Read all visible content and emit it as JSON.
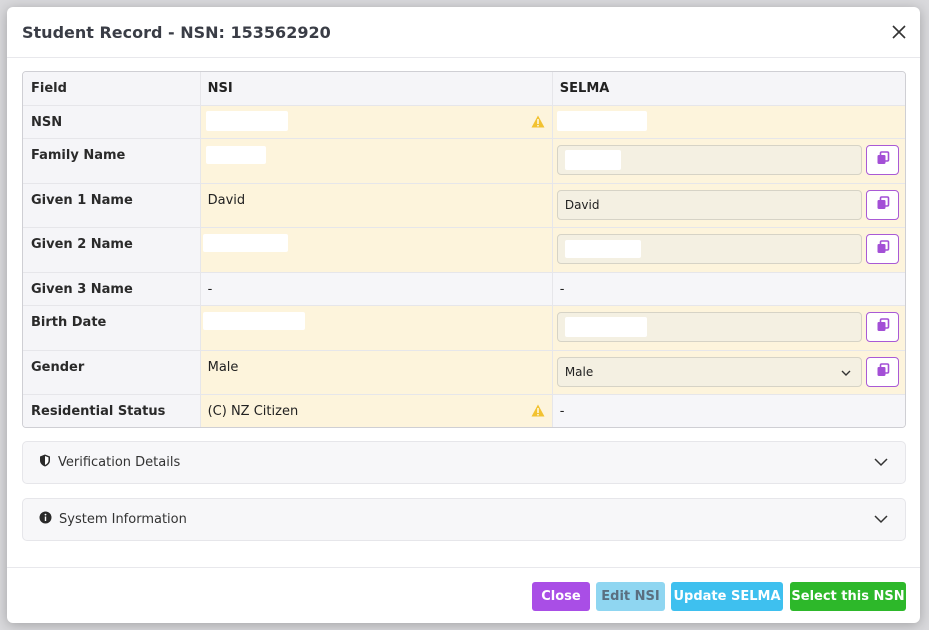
{
  "modal": {
    "title": "Student Record - NSN: 153562920"
  },
  "grid": {
    "headers": {
      "field": "Field",
      "nsi": "NSI",
      "selma": "SELMA"
    },
    "rows": [
      {
        "field": "NSN",
        "nsi": "",
        "selma": "",
        "warning": true
      },
      {
        "field": "Family Name",
        "nsi": "",
        "selma": ""
      },
      {
        "field": "Given 1 Name",
        "nsi": "David",
        "selma": "David"
      },
      {
        "field": "Given 2 Name",
        "nsi": "",
        "selma": ""
      },
      {
        "field": "Given 3 Name",
        "nsi": "-",
        "selma": "-"
      },
      {
        "field": "Birth Date",
        "nsi": "",
        "selma": ""
      },
      {
        "field": "Gender",
        "nsi": "Male",
        "selma": "Male"
      },
      {
        "field": "Residential Status",
        "nsi": "(C) NZ Citizen",
        "selma": "-",
        "warning": true
      }
    ]
  },
  "sections": {
    "verification": "Verification Details",
    "system": "System Information"
  },
  "buttons": {
    "close": "Close",
    "edit_nsi": "Edit NSI",
    "update_selma": "Update SELMA",
    "select_nsn": "Select this NSN"
  },
  "colors": {
    "close": "#a94ee6",
    "edit_nsi": "#8fd6f1",
    "update_selma": "#3ec0ef",
    "select_nsn": "#2db82a",
    "highlight": "#fdf4dc",
    "warning": "#f2c230",
    "copy_icon": "#a34fd6"
  },
  "icons": {
    "close": "close-icon",
    "warning": "warning-icon",
    "copy": "copy-icon",
    "shield": "shield-icon",
    "info": "info-icon",
    "chevron": "chevron-down-icon"
  }
}
